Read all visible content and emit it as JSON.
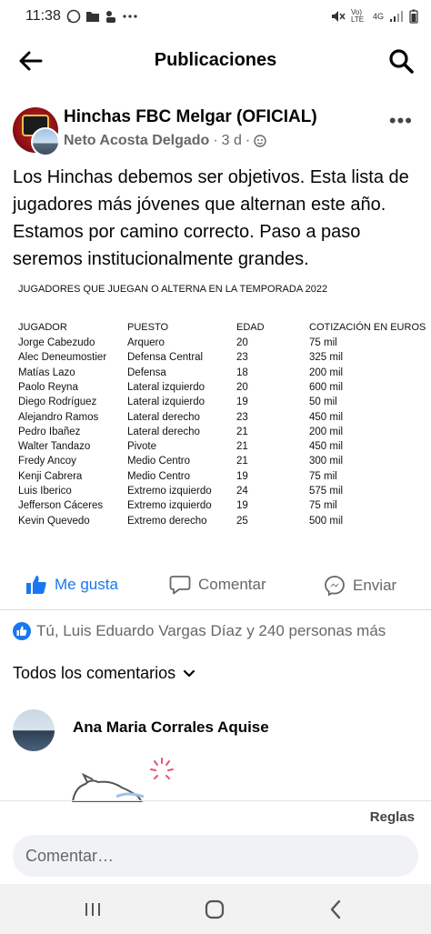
{
  "status_bar": {
    "time": "11:38",
    "volte": "Vo) LTE",
    "network": "4G"
  },
  "header": {
    "title": "Publicaciones"
  },
  "post": {
    "page_name": "Hinchas FBC Melgar (OFICIAL)",
    "author": "Neto Acosta Delgado",
    "time": "3 d",
    "text": "Los Hinchas debemos ser objetivos. Esta lista de jugadores más jóvenes que alternan este año. Estamos por camino correcto. Paso a paso seremos institucionalmente grandes."
  },
  "table_image": {
    "title": "JUGADORES QUE JUEGAN O ALTERNA EN LA TEMPORADA 2022",
    "headers": [
      "JUGADOR",
      "PUESTO",
      "EDAD",
      "COTIZACIÓN EN EUROS"
    ],
    "rows": [
      [
        "Jorge Cabezudo",
        "Arquero",
        "20",
        "75 mil"
      ],
      [
        "Alec Deneumostier",
        "Defensa Central",
        "23",
        "325 mil"
      ],
      [
        "Matías Lazo",
        "Defensa",
        "18",
        "200 mil"
      ],
      [
        "Paolo Reyna",
        "Lateral izquierdo",
        "20",
        "600 mil"
      ],
      [
        "Diego Rodríguez",
        "Lateral izquierdo",
        "19",
        "50 mil"
      ],
      [
        "Alejandro Ramos",
        "Lateral derecho",
        "23",
        "450 mil"
      ],
      [
        "Pedro Ibañez",
        "Lateral derecho",
        "21",
        "200 mil"
      ],
      [
        "Walter Tandazo",
        "Pivote",
        "21",
        "450 mil"
      ],
      [
        "Fredy Ancoy",
        "Medio Centro",
        "21",
        "300 mil"
      ],
      [
        "Kenji Cabrera",
        "Medio Centro",
        "19",
        "75 mil"
      ],
      [
        "Luis Iberico",
        "Extremo izquierdo",
        "24",
        "575 mil"
      ],
      [
        "Jefferson Cáceres",
        "Extremo izquierdo",
        "19",
        "75 mil"
      ],
      [
        "Kevin Quevedo",
        "Extremo derecho",
        "25",
        "500 mil"
      ]
    ]
  },
  "actions": {
    "like": "Me gusta",
    "comment": "Comentar",
    "send": "Enviar"
  },
  "reactions": {
    "text": "Tú, Luis Eduardo Vargas Díaz y 240 personas más"
  },
  "comments": {
    "filter_label": "Todos los comentarios",
    "first_commenter": "Ana Maria Corrales Aquise"
  },
  "composer": {
    "rules_label": "Reglas",
    "placeholder": "Comentar…"
  },
  "colors": {
    "accent": "#1877f2",
    "secondary_text": "#65676b"
  }
}
